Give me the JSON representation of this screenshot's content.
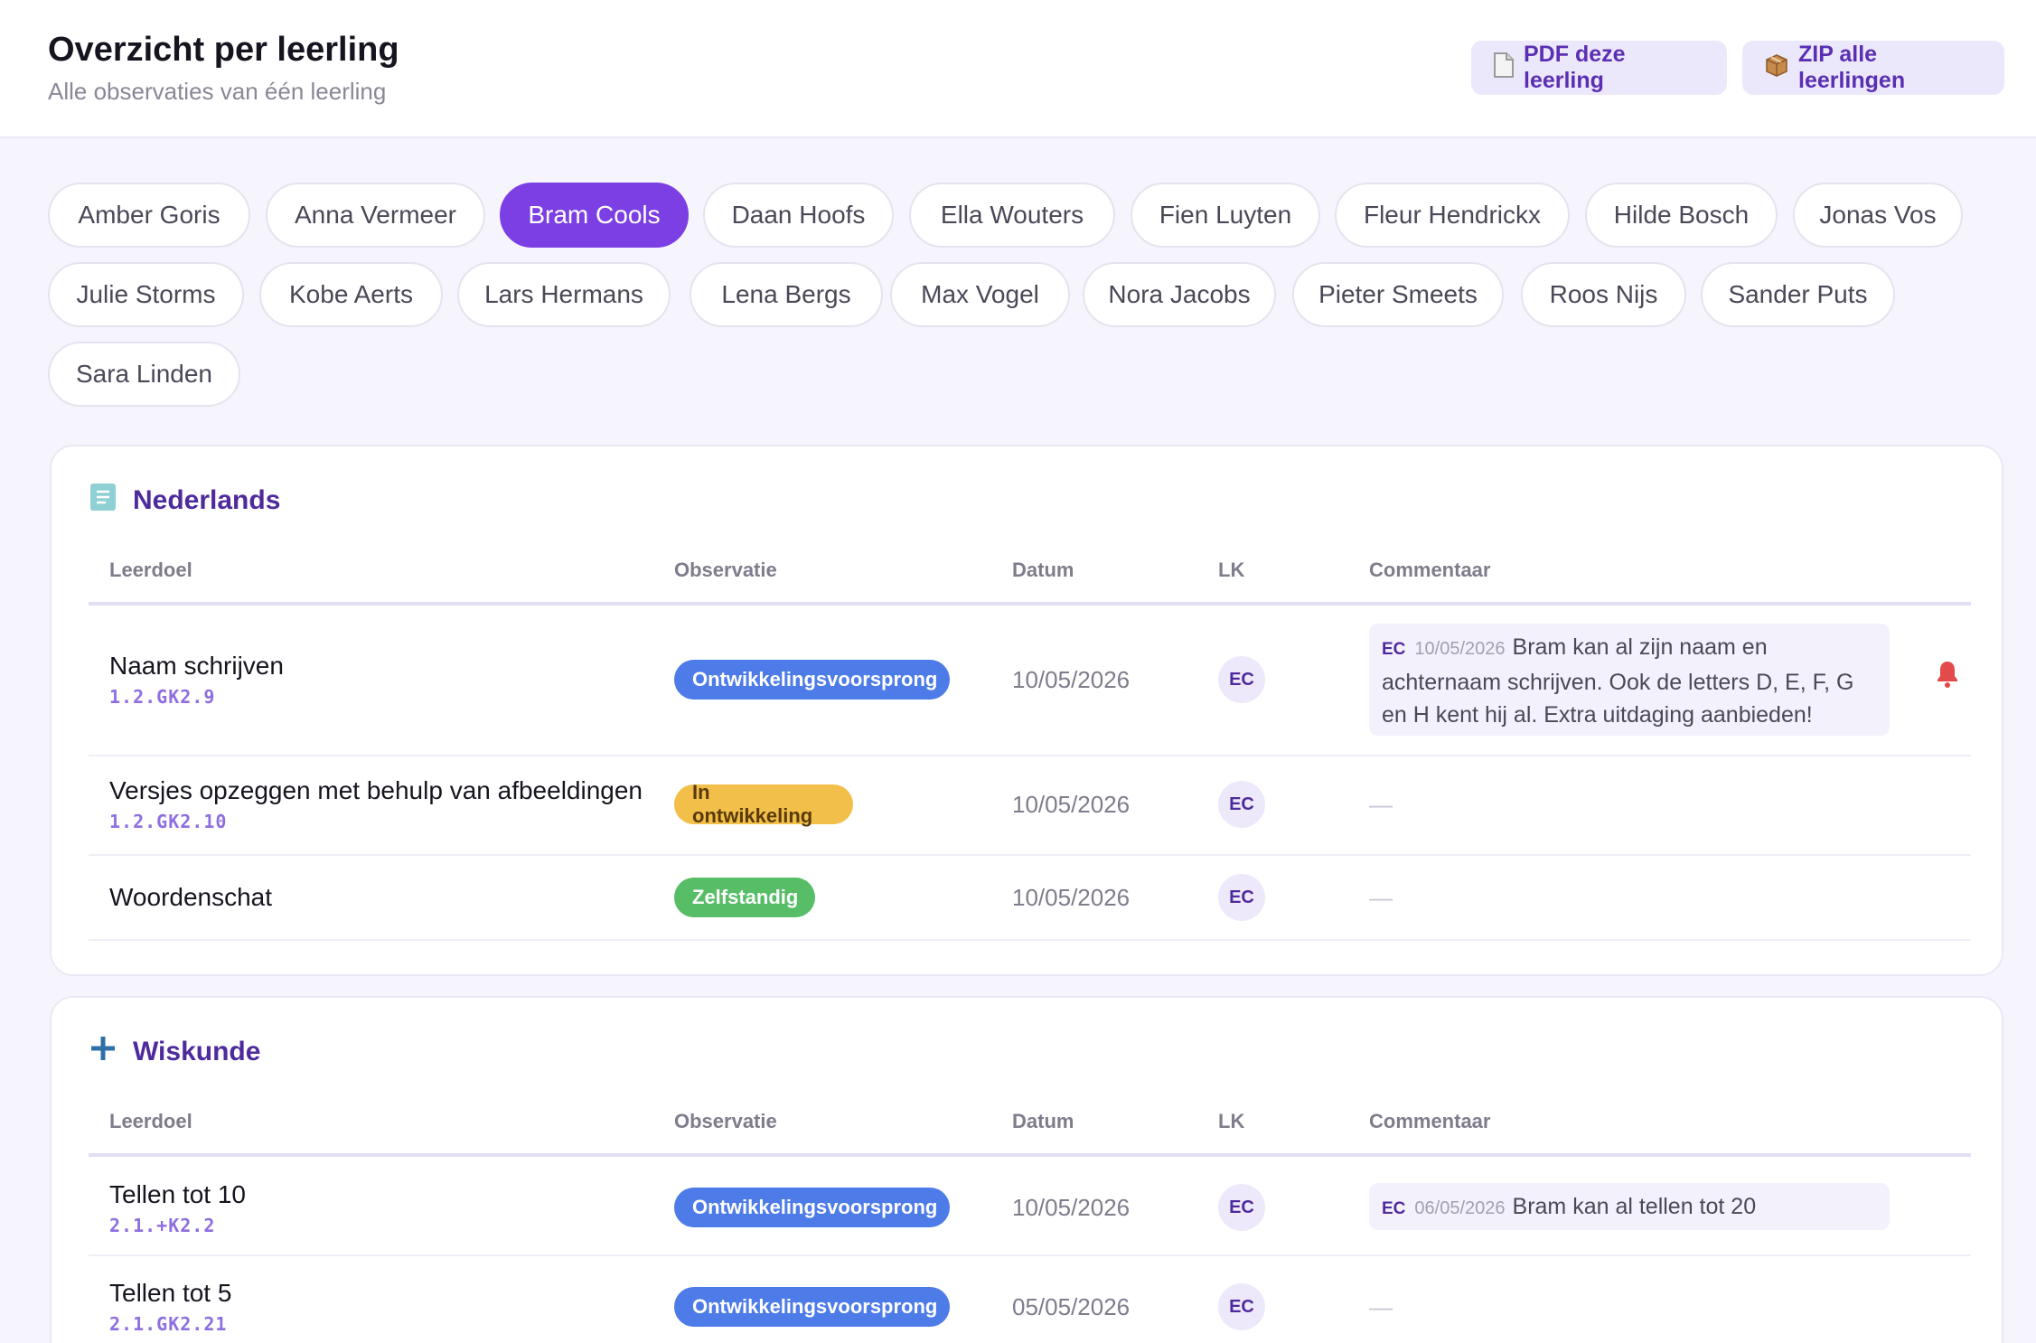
{
  "header": {
    "title": "Overzicht per leerling",
    "subtitle": "Alle observaties van één leerling",
    "pdf_label": "PDF deze leerling",
    "zip_label": "ZIP alle leerlingen",
    "pdf_icon": "document-icon",
    "zip_icon": "package-icon"
  },
  "students": [
    "Amber Goris",
    "Anna Vermeer",
    "Bram Cools",
    "Daan Hoofs",
    "Ella Wouters",
    "Fien Luyten",
    "Fleur Hendrickx",
    "Hilde Bosch",
    "Jonas Vos",
    "Julie Storms",
    "Kobe Aerts",
    "Lars Hermans",
    "Lena Bergs",
    "Max Vogel",
    "Nora Jacobs",
    "Pieter Smeets",
    "Roos Nijs",
    "Sander Puts",
    "Sara Linden"
  ],
  "selected_student": "Bram Cools",
  "columns": {
    "goal": "Leerdoel",
    "observation": "Observatie",
    "date": "Datum",
    "teacher": "LK",
    "comment": "Commentaar"
  },
  "sections": [
    {
      "title": "Nederlands",
      "icon": "book-icon",
      "rows": [
        {
          "goal": "Naam schrijven",
          "code": "1.2.GK2.9",
          "status": "Ontwikkelingsvoorsprong",
          "date": "10/05/2026",
          "teacher": "EC",
          "comment": {
            "teacher": "EC",
            "date": "10/05/2026",
            "text": "Bram kan al zijn naam en achternaam schrijven. Ook de letters D, E, F, G en H kent hij al. Extra uitdaging aanbieden!"
          },
          "alert": true
        },
        {
          "goal": "Versjes opzeggen met behulp van afbeeldingen",
          "code": "1.2.GK2.10",
          "status": "In ontwikkeling",
          "date": "10/05/2026",
          "teacher": "EC",
          "comment_empty": "—"
        },
        {
          "goal": "Woordenschat",
          "status": "Zelfstandig",
          "date": "10/05/2026",
          "teacher": "EC",
          "comment_empty": "—"
        }
      ]
    },
    {
      "title": "Wiskunde",
      "icon": "plus-icon",
      "rows": [
        {
          "goal": "Tellen tot 10",
          "code": "2.1.+K2.2",
          "status": "Ontwikkelingsvoorsprong",
          "date": "10/05/2026",
          "teacher": "EC",
          "comment": {
            "teacher": "EC",
            "date": "06/05/2026",
            "text": "Bram kan al tellen tot 20"
          }
        },
        {
          "goal": "Tellen tot 5",
          "code": "2.1.GK2.21",
          "status": "Ontwikkelingsvoorsprong",
          "date": "05/05/2026",
          "teacher": "EC",
          "comment_empty": "—"
        }
      ]
    }
  ],
  "colors": {
    "accent": "#7b3fe4",
    "ahead": "#4d7be7",
    "developing": "#f2c04a",
    "independent": "#57bd66",
    "alert": "#e34b4b"
  }
}
